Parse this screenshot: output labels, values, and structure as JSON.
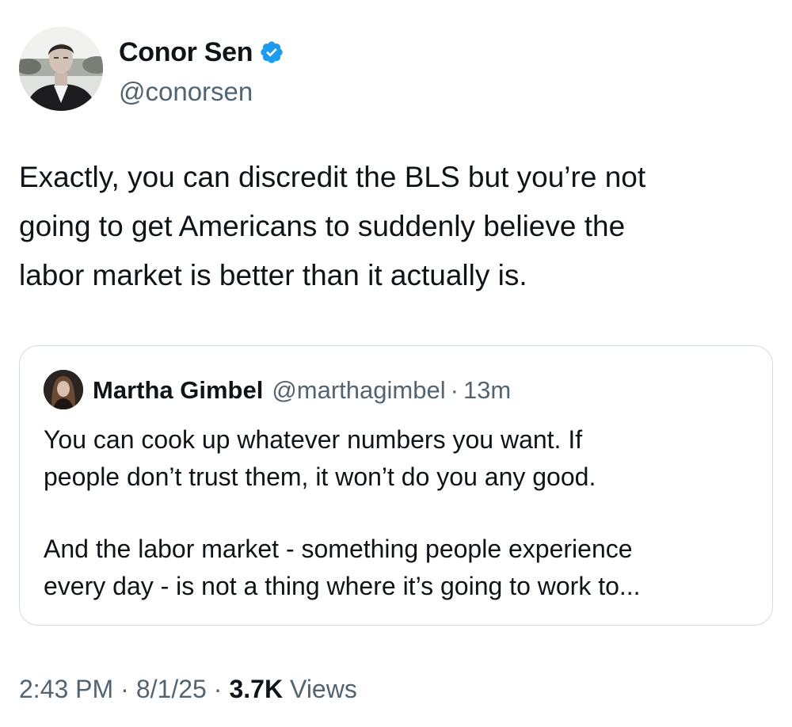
{
  "tweet": {
    "author": {
      "display_name": "Conor Sen",
      "handle": "@conorsen",
      "verified": true
    },
    "text": "Exactly, you can discredit the BLS but you’re not\ngoing to get Americans to suddenly believe the\nlabor market is better than it actually is.",
    "quoted_tweet": {
      "display_name": "Martha Gimbel",
      "handle": "@marthagimbel",
      "separator": "·",
      "time_ago": "13m",
      "paragraphs": [
        "You can cook up whatever numbers you want. If\npeople don’t trust them, it won’t do you any good.",
        "And the labor market - something people experience\nevery day - is not a thing where it’s going to work to..."
      ]
    },
    "meta": {
      "time": "2:43 PM",
      "separator": "·",
      "date": "8/1/25",
      "views_count": "3.7K",
      "views_label": "Views"
    }
  },
  "colors": {
    "text_primary": "#0f1419",
    "text_secondary": "#536471",
    "verified_blue": "#1d9bf0",
    "card_border": "#d4dbe1"
  },
  "icons": {
    "verified": "verified-badge-icon"
  }
}
